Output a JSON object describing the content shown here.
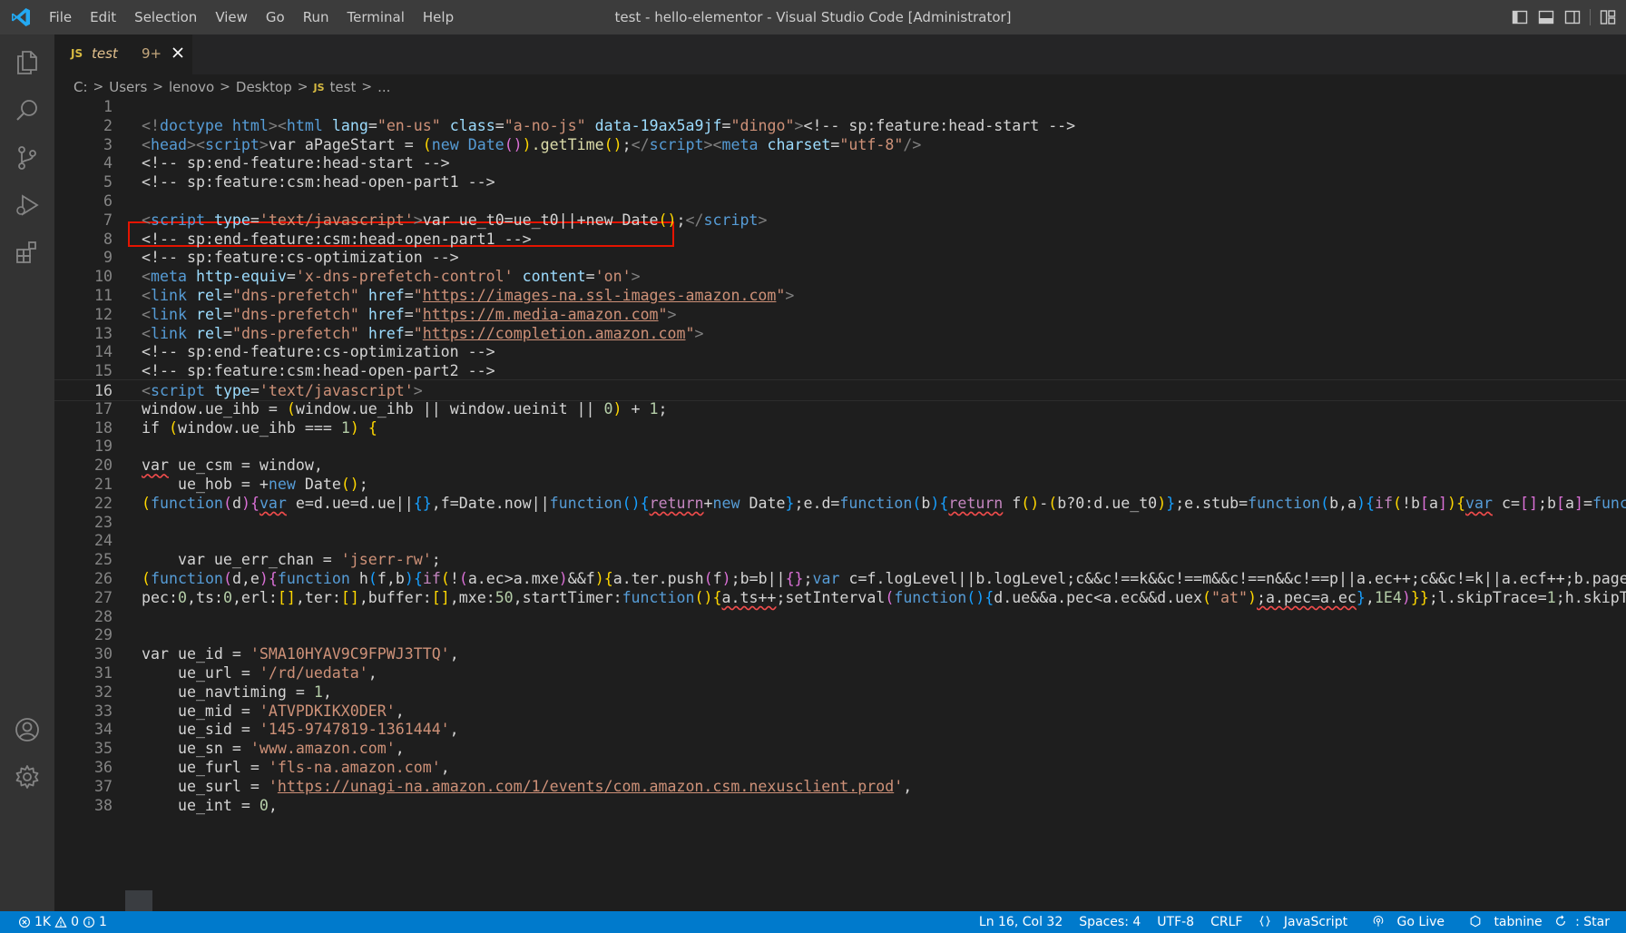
{
  "window": {
    "title": "test - hello-elementor - Visual Studio Code [Administrator]",
    "menu": [
      "File",
      "Edit",
      "Selection",
      "View",
      "Go",
      "Run",
      "Terminal",
      "Help"
    ]
  },
  "tab": {
    "lang_badge": "JS",
    "title": "test",
    "problem_count": "9+"
  },
  "breadcrumb": {
    "items": [
      "C:",
      "Users",
      "lenovo",
      "Desktop"
    ],
    "file_badge": "JS",
    "file": "test",
    "tail": "..."
  },
  "editor": {
    "current_line": 16,
    "lines": [
      {
        "n": "1"
      },
      {
        "n": "2"
      },
      {
        "n": "3"
      },
      {
        "n": "4"
      },
      {
        "n": "5"
      },
      {
        "n": "6"
      },
      {
        "n": "7"
      },
      {
        "n": "8"
      },
      {
        "n": "9"
      },
      {
        "n": "10"
      },
      {
        "n": "11"
      },
      {
        "n": "12"
      },
      {
        "n": "13"
      },
      {
        "n": "14"
      },
      {
        "n": "15"
      },
      {
        "n": "16"
      },
      {
        "n": "17"
      },
      {
        "n": "18"
      },
      {
        "n": "19"
      },
      {
        "n": "20"
      },
      {
        "n": "21"
      },
      {
        "n": "22"
      },
      {
        "n": "23"
      },
      {
        "n": "24"
      },
      {
        "n": "25"
      },
      {
        "n": "26"
      },
      {
        "n": "27"
      },
      {
        "n": "28"
      },
      {
        "n": "29"
      },
      {
        "n": "30"
      },
      {
        "n": "31"
      },
      {
        "n": "32"
      },
      {
        "n": "33"
      },
      {
        "n": "34"
      },
      {
        "n": "35"
      },
      {
        "n": "36"
      },
      {
        "n": "37"
      },
      {
        "n": "38"
      }
    ],
    "tokens": {
      "l2": [
        "<!",
        "doctype",
        " ",
        "html",
        ">",
        "<",
        "html",
        " ",
        "lang",
        "=",
        "\"en-us\"",
        " ",
        "class",
        "=",
        "\"a-no-js\"",
        " ",
        "data-19ax5a9jf",
        "=",
        "\"dingo\"",
        ">",
        "<!-- sp:feature:head-start -->"
      ],
      "l3": [
        "<",
        "head",
        "><",
        "script",
        ">",
        "var aPageStart = ",
        "(",
        "new Date",
        "()",
        ")",
        ".getTime",
        "()",
        ";",
        "</",
        "script",
        "><",
        "meta",
        " ",
        "charset",
        "=",
        "\"utf-8\"",
        "/>"
      ],
      "l4": "<!-- sp:end-feature:head-start -->",
      "l5": "<!-- sp:feature:csm:head-open-part1 -->",
      "l7": [
        "<",
        "script",
        " ",
        "type",
        "=",
        "'text/javascript'",
        ">",
        "var ue_t0=ue_t0||+new Date",
        "()",
        ";",
        "</",
        "script",
        ">"
      ],
      "l8": "<!-- sp:end-feature:csm:head-open-part1 -->",
      "l9": "<!-- sp:feature:cs-optimization -->",
      "l10": [
        "<",
        "meta",
        " ",
        "http-equiv",
        "=",
        "'x-dns-prefetch-control'",
        " ",
        "content",
        "=",
        "'on'",
        ">"
      ],
      "l11": [
        "<",
        "link",
        " ",
        "rel",
        "=",
        "\"dns-prefetch\"",
        " ",
        "href",
        "=",
        "\"",
        "https://images-na.ssl-images-amazon.com",
        "\"",
        ">"
      ],
      "l12": [
        "<",
        "link",
        " ",
        "rel",
        "=",
        "\"dns-prefetch\"",
        " ",
        "href",
        "=",
        "\"",
        "https://m.media-amazon.com",
        "\"",
        ">"
      ],
      "l13": [
        "<",
        "link",
        " ",
        "rel",
        "=",
        "\"dns-prefetch\"",
        " ",
        "href",
        "=",
        "\"",
        "https://completion.amazon.com",
        "\"",
        ">"
      ],
      "l14": "<!-- sp:end-feature:cs-optimization -->",
      "l15": "<!-- sp:feature:csm:head-open-part2 -->",
      "l16": [
        "<",
        "script",
        " ",
        "type",
        "=",
        "'text/javascript'",
        ">"
      ],
      "l17": [
        "window.ue_ihb = ",
        "(",
        "window.ue_ihb || window.ueinit || ",
        "0",
        ")",
        " + ",
        "1",
        ";"
      ],
      "l18": [
        "if ",
        "(",
        "window.ue_ihb === ",
        "1",
        ")",
        " ",
        "{"
      ],
      "l20": [
        "var",
        " ue_csm = window,"
      ],
      "l21": [
        "    ue_hob = +",
        "new",
        " Date",
        "()",
        ";"
      ],
      "l22": [
        "(",
        "function",
        "(",
        "d",
        ")",
        "{",
        "var",
        " e=d.ue=d.ue||",
        "{}",
        ",f=Date.now||",
        "function",
        "()",
        "{",
        "return",
        "+",
        "new",
        " Date",
        "}",
        ";e.d=",
        "function",
        "(",
        "b",
        ")",
        "{",
        "return",
        " f",
        "()",
        "-",
        "(",
        "b?0:d.ue_t0",
        ")",
        "}",
        ";e.stub=",
        "function",
        "(",
        "b,a",
        ")",
        "{",
        "if",
        "(",
        "!b",
        "[",
        "a",
        "]",
        ")",
        "{",
        "var",
        " c=",
        "[]",
        ";b",
        "[",
        "a",
        "]",
        "=",
        "function",
        "("
      ],
      "l25": [
        "    var ue_err_chan = ",
        "'jserr-rw'",
        ";"
      ],
      "l26": [
        "(",
        "function",
        "(",
        "d,e",
        ")",
        "{",
        "function",
        " h",
        "(",
        "f,b",
        ")",
        "{",
        "if",
        "(",
        "!",
        "(",
        "a.ec>a.mxe",
        ")",
        "&&f",
        ")",
        "{",
        "a.ter.push",
        "(",
        "f",
        ")",
        ";b=b||",
        "{}",
        ";",
        "var",
        " c=f.logLevel||b.logLevel;c&&c!==k&&c!==m&&c!==n&&c!==p||a.ec++;c&&c!=k||a.ecf++;b.pageURL=\""
      ],
      "l27": [
        "pec:",
        "0",
        ",ts:",
        "0",
        ",erl:",
        "[]",
        ",ter:",
        "[]",
        ",buffer:",
        "[]",
        ",mxe:",
        "50",
        ",startTimer:",
        "function",
        "()",
        "{",
        "a.ts++",
        ";setInterval",
        "(",
        "function",
        "()",
        "{",
        "d.ue&&a.pec<a.ec&&d.uex",
        "(",
        "\"at\"",
        ")",
        ";a.pec=a.ec",
        "}",
        ",",
        "1E4",
        ")",
        "}",
        "}",
        ";l.skipTrace=",
        "1",
        ";h.skipTrace="
      ],
      "l30": [
        "var ue_id = ",
        "'SMA10HYAV9C9FPWJ3TTQ'",
        ","
      ],
      "l31": [
        "    ue_url = ",
        "'/rd/uedata'",
        ","
      ],
      "l32": [
        "    ue_navtiming = ",
        "1",
        ","
      ],
      "l33": [
        "    ue_mid = ",
        "'ATVPDKIKX0DER'",
        ","
      ],
      "l34": [
        "    ue_sid = ",
        "'145-9747819-1361444'",
        ","
      ],
      "l35": [
        "    ue_sn = ",
        "'www.amazon.com'",
        ","
      ],
      "l36": [
        "    ue_furl = ",
        "'fls-na.amazon.com'",
        ","
      ],
      "l37": [
        "    ue_surl = ",
        "'",
        "https://unagi-na.amazon.com/1/events/com.amazon.csm.nexusclient.prod",
        "'",
        ","
      ],
      "l38": [
        "    ue_int = ",
        "0",
        ","
      ]
    }
  },
  "status": {
    "errors": "1K",
    "warnings": "0",
    "infos": "1",
    "position": "Ln 16, Col 32",
    "spaces": "Spaces: 4",
    "encoding": "UTF-8",
    "eol": "CRLF",
    "language": "JavaScript",
    "go_live": "Go Live",
    "tabnine": "tabnine",
    "tabnine_tail": ": Star"
  },
  "colors": {
    "titlebar": "#3c3c3c",
    "activitybar": "#333333",
    "editor": "#1e1e1e",
    "statusbar": "#007acc",
    "highlight_box": "#e51400"
  }
}
